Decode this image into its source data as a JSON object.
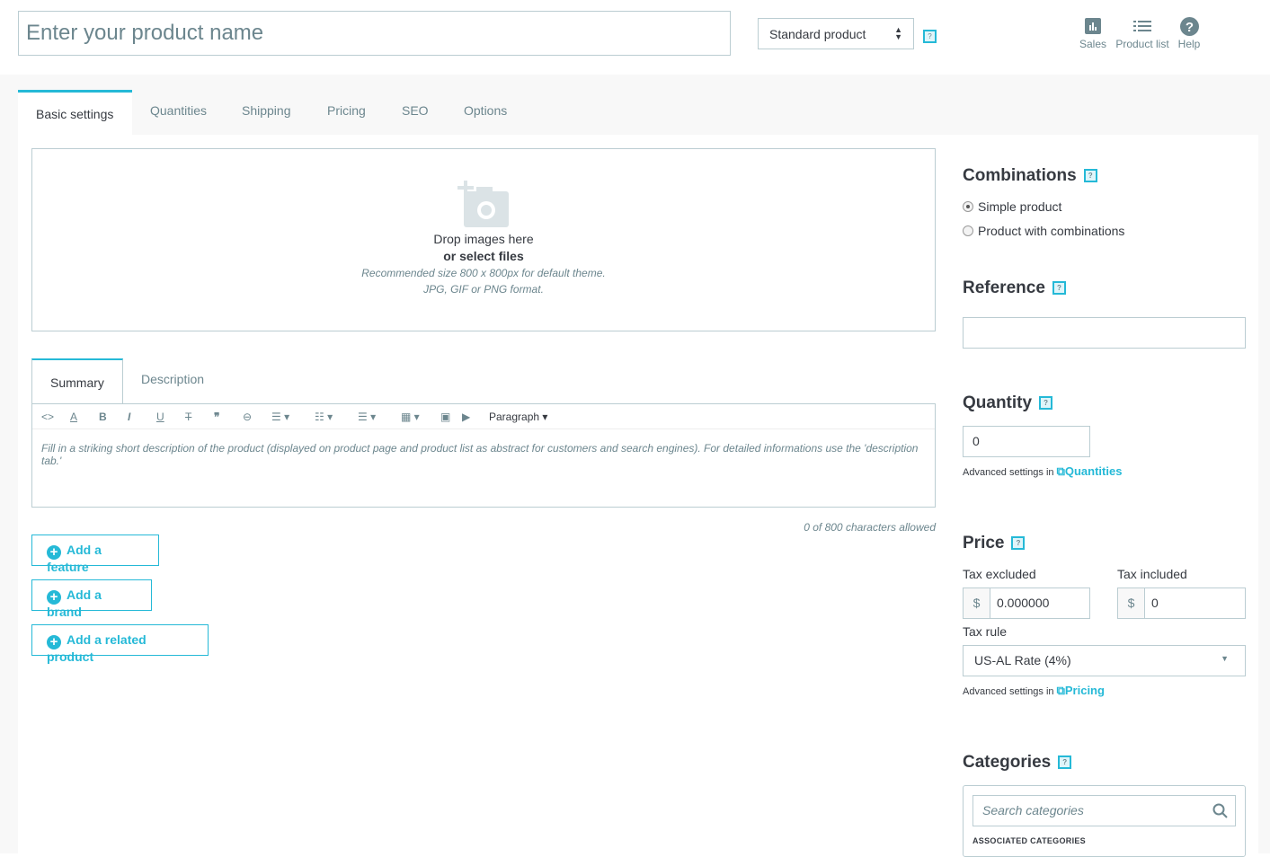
{
  "header": {
    "product_name_placeholder": "Enter your product name",
    "product_type": "Standard product",
    "help": "?",
    "actions": [
      {
        "label": "Sales",
        "icon": "bar-chart-icon"
      },
      {
        "label": "Product list",
        "icon": "list-icon"
      },
      {
        "label": "Help",
        "icon": "help-circle-icon"
      }
    ]
  },
  "tabs": [
    "Basic settings",
    "Quantities",
    "Shipping",
    "Pricing",
    "SEO",
    "Options"
  ],
  "dropzone": {
    "line1": "Drop images here",
    "line2": "or select files",
    "line3": "Recommended size 800 x 800px for default theme.",
    "line4": "JPG, GIF or PNG format."
  },
  "editor": {
    "tabs": [
      "Summary",
      "Description"
    ],
    "format": "Paragraph",
    "placeholder": "Fill in a striking short description of the product (displayed on product page and product list as abstract for customers and search engines). For detailed informations use the 'description tab.'",
    "count": "0 of 800 characters allowed"
  },
  "buttons": {
    "feature": "Add a feature",
    "brand": "Add a brand",
    "related": "Add a related product"
  },
  "combinations": {
    "title": "Combinations",
    "options": [
      "Simple product",
      "Product with combinations"
    ],
    "selected": 0
  },
  "reference": {
    "title": "Reference",
    "value": ""
  },
  "quantity": {
    "title": "Quantity",
    "value": "0",
    "adv_text": "Advanced settings in",
    "adv_link": "Quantities"
  },
  "price": {
    "title": "Price",
    "tax_excluded_label": "Tax excluded",
    "tax_included_label": "Tax included",
    "currency": "$",
    "tax_excluded": "0.000000",
    "tax_included": "0",
    "tax_rule_label": "Tax rule",
    "tax_rule": "US-AL Rate (4%)",
    "adv_text": "Advanced settings in",
    "adv_link": "Pricing"
  },
  "categories": {
    "title": "Categories",
    "search_placeholder": "Search categories",
    "associated": "ASSOCIATED CATEGORIES"
  },
  "colors": {
    "accent": "#25b9d7",
    "text": "#363a41",
    "muted": "#6c868e"
  }
}
